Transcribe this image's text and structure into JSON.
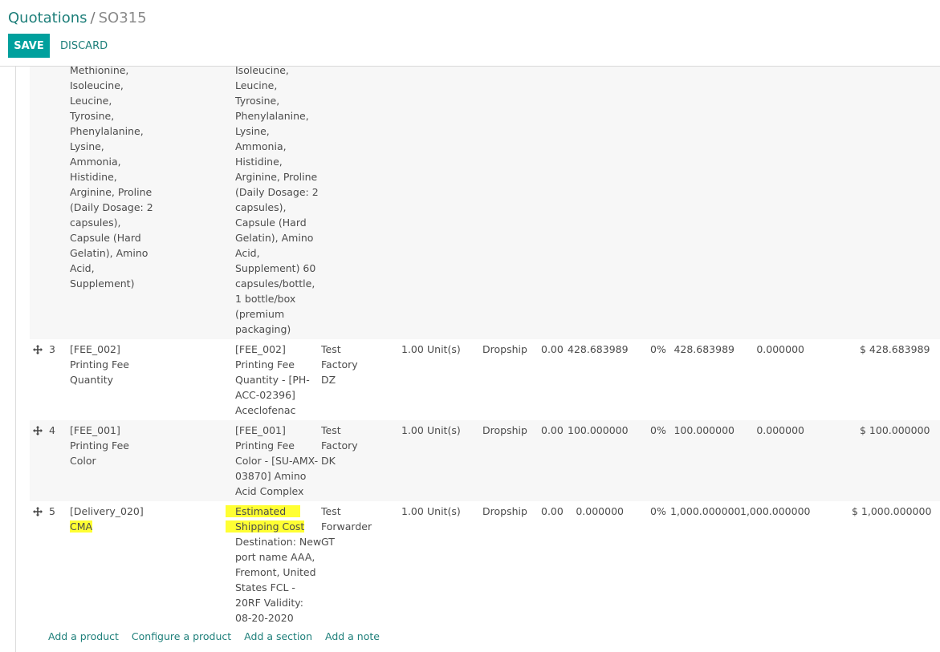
{
  "breadcrumb": {
    "parent": "Quotations",
    "separator": "/",
    "current": "SO315"
  },
  "toolbar": {
    "save_label": "SAVE",
    "discard_label": "DISCARD"
  },
  "continued_row": {
    "product_lines": [
      "Methionine,",
      "Isoleucine,",
      "Leucine,",
      "Tyrosine,",
      "Phenylalanine,",
      "Lysine,",
      "Ammonia,",
      "Histidine,",
      "Arginine, Proline",
      "(Daily Dosage: 2",
      "capsules),",
      "Capsule (Hard",
      "Gelatin), Amino",
      "Acid,",
      "Supplement)"
    ],
    "description_lines": [
      "Isoleucine,",
      "Leucine,",
      "Tyrosine,",
      "Phenylalanine,",
      "Lysine,",
      "Ammonia,",
      "Histidine,",
      "Arginine, Proline",
      "(Daily Dosage: 2",
      "capsules),",
      "Capsule (Hard",
      "Gelatin), Amino",
      "Acid,",
      "Supplement) 60",
      "capsules/bottle,",
      "1 bottle/box",
      "(premium",
      "packaging)"
    ]
  },
  "lines": [
    {
      "seq": "3",
      "product_lines": [
        "[FEE_002]",
        "Printing Fee",
        "Quantity"
      ],
      "description_lines": [
        "[FEE_002]",
        "Printing Fee",
        "Quantity - [PH-",
        "ACC-02396]",
        "Aceclofenac"
      ],
      "vendor_lines": [
        "Test",
        "Factory",
        "DZ"
      ],
      "qty": "1.00",
      "uom": "Unit(s)",
      "route": "Dropship",
      "delivered": "0.00",
      "unit_price": "428.683989",
      "discount": "0%",
      "cost": "428.683989",
      "margin": "0.000000",
      "subtotal": "$ 428.683989"
    },
    {
      "seq": "4",
      "product_lines": [
        "[FEE_001]",
        "Printing Fee",
        "Color"
      ],
      "description_lines": [
        "[FEE_001]",
        "Printing Fee",
        "Color - [SU-AMX-",
        "03870] Amino",
        "Acid Complex"
      ],
      "vendor_lines": [
        "Test",
        "Factory",
        "DK"
      ],
      "qty": "1.00",
      "uom": "Unit(s)",
      "route": "Dropship",
      "delivered": "0.00",
      "unit_price": "100.000000",
      "discount": "0%",
      "cost": "100.000000",
      "margin": "0.000000",
      "subtotal": "$ 100.000000"
    },
    {
      "seq": "5",
      "product_lines": [
        "[Delivery_020]",
        "CMA"
      ],
      "description_lines": [
        "Estimated",
        "Shipping Cost",
        "Destination: New",
        "port name AAA,",
        "Fremont, United",
        "States FCL -",
        "20RF Validity:",
        "08-20-2020"
      ],
      "vendor_lines": [
        "Test",
        "Forwarder",
        "GT"
      ],
      "qty": "1.00",
      "uom": "Unit(s)",
      "route": "Dropship",
      "delivered": "0.00",
      "unit_price": "0.000000",
      "discount": "0%",
      "cost": "1,000.000000",
      "margin": "1,000.000000",
      "subtotal": "$ 1,000.000000"
    }
  ],
  "footer": {
    "add_product": "Add a product",
    "configure_product": "Configure a product",
    "add_section": "Add a section",
    "add_note": "Add a note"
  },
  "icons": {
    "drag": "arrows-move-icon"
  },
  "colors": {
    "accent": "#00a09d",
    "link": "#1e7f7a",
    "highlight": "#ffff33",
    "row_alt": "#f7f7f7"
  }
}
